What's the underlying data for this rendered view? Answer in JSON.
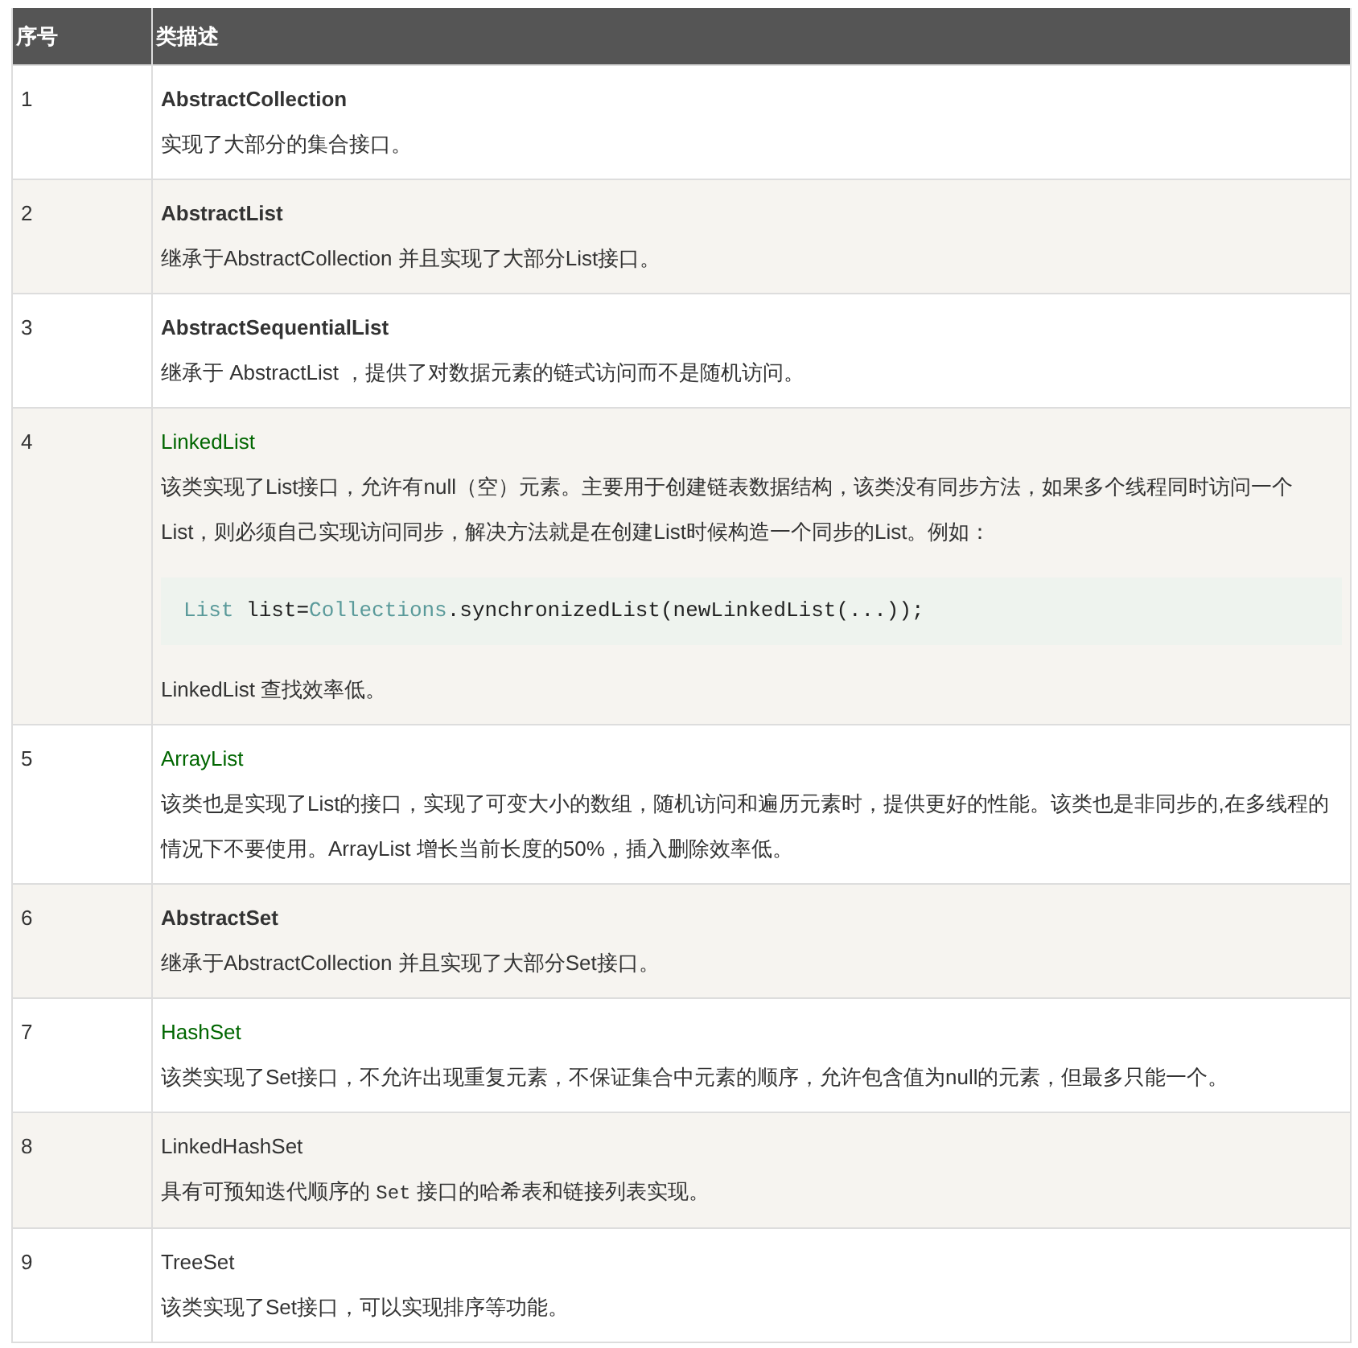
{
  "table": {
    "columns": [
      "序号",
      "类描述"
    ],
    "rows": [
      {
        "index": "1",
        "name": {
          "text": "AbstractCollection",
          "kind": "bold"
        },
        "blocks": [
          {
            "kind": "text",
            "parts": [
              {
                "kind": "text",
                "text": "实现了大部分的集合接口。"
              }
            ]
          }
        ]
      },
      {
        "index": "2",
        "name": {
          "text": "AbstractList",
          "kind": "bold"
        },
        "blocks": [
          {
            "kind": "text",
            "parts": [
              {
                "kind": "text",
                "text": "继承于AbstractCollection 并且实现了大部分List接口。"
              }
            ]
          }
        ]
      },
      {
        "index": "3",
        "name": {
          "text": "AbstractSequentialList",
          "kind": "bold"
        },
        "blocks": [
          {
            "kind": "text",
            "parts": [
              {
                "kind": "text",
                "text": "继承于 AbstractList ，提供了对数据元素的链式访问而不是随机访问。"
              }
            ]
          }
        ]
      },
      {
        "index": "4",
        "name": {
          "text": "LinkedList",
          "kind": "link"
        },
        "blocks": [
          {
            "kind": "text",
            "parts": [
              {
                "kind": "text",
                "text": "该类实现了List接口，允许有null（空）元素。主要用于创建链表数据结构，该类没有同步方法，如果多个线程同时访问一个List，则必须自己实现访问同步，解决方法就是在创建List时候构造一个同步的List。例如："
              }
            ]
          },
          {
            "kind": "code",
            "parts": [
              {
                "kind": "type",
                "text": "List"
              },
              {
                "kind": "text",
                "text": " list="
              },
              {
                "kind": "type",
                "text": "Collections"
              },
              {
                "kind": "text",
                "text": ".synchronizedList(newLinkedList(...));"
              }
            ]
          },
          {
            "kind": "text",
            "parts": [
              {
                "kind": "text",
                "text": "LinkedList 查找效率低。"
              }
            ]
          }
        ]
      },
      {
        "index": "5",
        "name": {
          "text": "ArrayList",
          "kind": "link"
        },
        "blocks": [
          {
            "kind": "text",
            "parts": [
              {
                "kind": "text",
                "text": "该类也是实现了List的接口，实现了可变大小的数组，随机访问和遍历元素时，提供更好的性能。该类也是非同步的,在多线程的情况下不要使用。ArrayList 增长当前长度的50%，插入删除效率低。"
              }
            ]
          }
        ]
      },
      {
        "index": "6",
        "name": {
          "text": "AbstractSet",
          "kind": "bold"
        },
        "blocks": [
          {
            "kind": "text",
            "parts": [
              {
                "kind": "text",
                "text": "继承于AbstractCollection 并且实现了大部分Set接口。"
              }
            ]
          }
        ]
      },
      {
        "index": "7",
        "name": {
          "text": "HashSet",
          "kind": "link"
        },
        "blocks": [
          {
            "kind": "text",
            "parts": [
              {
                "kind": "text",
                "text": "该类实现了Set接口，不允许出现重复元素，不保证集合中元素的顺序，允许包含值为null的元素，但最多只能一个。"
              }
            ]
          }
        ]
      },
      {
        "index": "8",
        "name": {
          "text": "LinkedHashSet",
          "kind": "plain"
        },
        "blocks": [
          {
            "kind": "text",
            "parts": [
              {
                "kind": "text",
                "text": "具有可预知迭代顺序的 "
              },
              {
                "kind": "code",
                "text": "Set"
              },
              {
                "kind": "text",
                "text": " 接口的哈希表和链接列表实现。"
              }
            ]
          }
        ]
      },
      {
        "index": "9",
        "name": {
          "text": "TreeSet",
          "kind": "plain"
        },
        "blocks": [
          {
            "kind": "text",
            "parts": [
              {
                "kind": "text",
                "text": "该类实现了Set接口，可以实现排序等功能。"
              }
            ]
          }
        ]
      }
    ]
  }
}
